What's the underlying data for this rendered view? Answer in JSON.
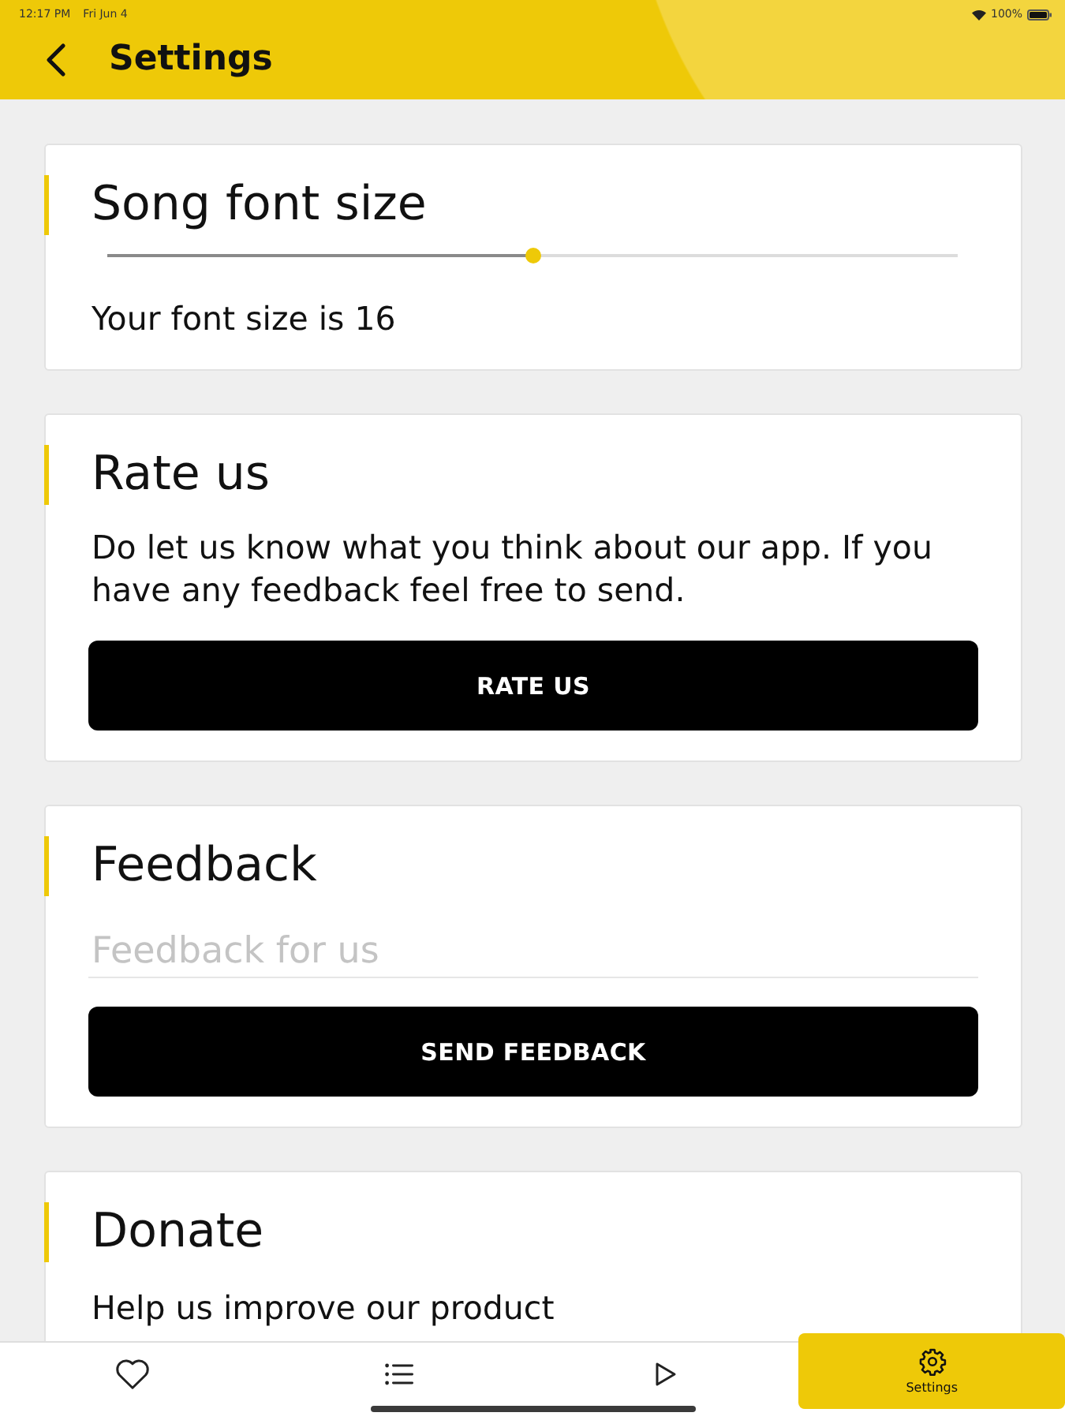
{
  "status_bar": {
    "time": "12:17 PM",
    "date": "Fri Jun 4",
    "battery": "100%"
  },
  "header": {
    "title": "Settings"
  },
  "sections": [
    {
      "kind": "slider",
      "title": "Song font size",
      "level": 0.5,
      "caption": "Your font size is 16"
    },
    {
      "kind": "action",
      "title": "Rate us",
      "description": "Do let us know what you think about our app. If you have any feedback feel free to send.",
      "button": "RATE US"
    },
    {
      "kind": "form",
      "title": "Feedback",
      "field": {
        "placeholder": "Feedback for us"
      },
      "button": "SEND FEEDBACK"
    },
    {
      "kind": "text",
      "title": "Donate",
      "description": "Help us improve our product"
    }
  ],
  "bottom_nav": {
    "tabs": [
      {
        "kind": "heart",
        "selected": false
      },
      {
        "kind": "list",
        "selected": false
      },
      {
        "kind": "play",
        "selected": false
      },
      {
        "kind": "gear",
        "label": "Settings",
        "selected": true
      }
    ]
  }
}
